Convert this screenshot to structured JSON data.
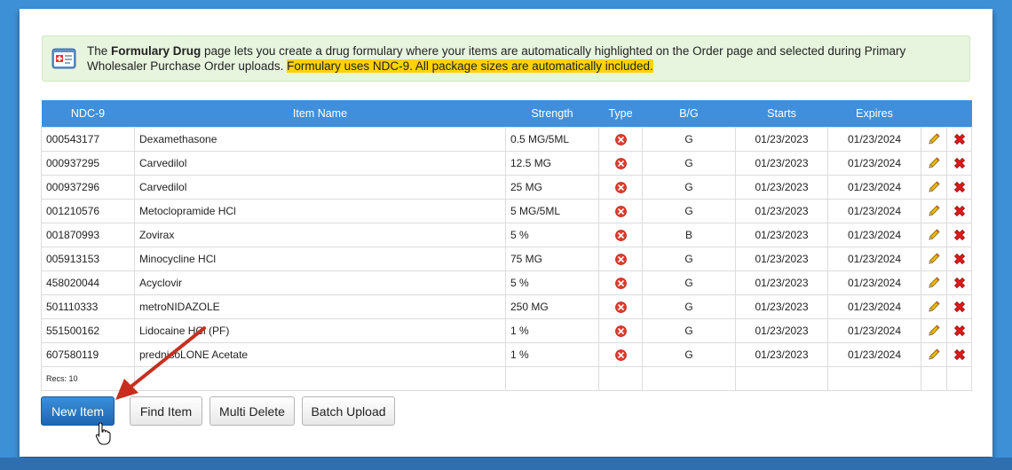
{
  "info": {
    "prefix": "The ",
    "bold": "Formulary Drug",
    "middle": " page lets you create a drug formulary where your items are automatically highlighted on the Order page and selected during Primary Wholesaler Purchase Order uploads. ",
    "highlight": "Formulary uses NDC-9. All package sizes are automatically included.",
    "icon": "formulary-icon"
  },
  "table": {
    "headers": {
      "ndc": "NDC-9",
      "item": "Item Name",
      "strength": "Strength",
      "type": "Type",
      "bg": "B/G",
      "starts": "Starts",
      "expires": "Expires"
    },
    "rows": [
      {
        "ndc": "000543177",
        "item": "Dexamethasone",
        "strength": "0.5 MG/5ML",
        "bg": "G",
        "starts": "01/23/2023",
        "expires": "01/23/2024"
      },
      {
        "ndc": "000937295",
        "item": "Carvedilol",
        "strength": "12.5 MG",
        "bg": "G",
        "starts": "01/23/2023",
        "expires": "01/23/2024"
      },
      {
        "ndc": "000937296",
        "item": "Carvedilol",
        "strength": "25 MG",
        "bg": "G",
        "starts": "01/23/2023",
        "expires": "01/23/2024"
      },
      {
        "ndc": "001210576",
        "item": "Metoclopramide HCl",
        "strength": "5 MG/5ML",
        "bg": "G",
        "starts": "01/23/2023",
        "expires": "01/23/2024"
      },
      {
        "ndc": "001870993",
        "item": "Zovirax",
        "strength": "5 %",
        "bg": "B",
        "starts": "01/23/2023",
        "expires": "01/23/2024"
      },
      {
        "ndc": "005913153",
        "item": "Minocycline HCl",
        "strength": "75 MG",
        "bg": "G",
        "starts": "01/23/2023",
        "expires": "01/23/2024"
      },
      {
        "ndc": "458020044",
        "item": "Acyclovir",
        "strength": "5 %",
        "bg": "G",
        "starts": "01/23/2023",
        "expires": "01/23/2024"
      },
      {
        "ndc": "501110333",
        "item": "metroNIDAZOLE",
        "strength": "250 MG",
        "bg": "G",
        "starts": "01/23/2023",
        "expires": "01/23/2024"
      },
      {
        "ndc": "551500162",
        "item": "Lidocaine HCl (PF)",
        "strength": "1 %",
        "bg": "G",
        "starts": "01/23/2023",
        "expires": "01/23/2024"
      },
      {
        "ndc": "607580119",
        "item": "prednisoLONE Acetate",
        "strength": "1 %",
        "bg": "G",
        "starts": "01/23/2023",
        "expires": "01/23/2024"
      }
    ],
    "type_icon": "red-x-circle-icon",
    "edit_icon": "pencil-icon",
    "delete_icon": "red-x-icon",
    "recs": "Recs: 10"
  },
  "buttons": {
    "new_item": "New Item",
    "find_item": "Find Item",
    "multi_delete": "Multi Delete",
    "batch_upload": "Batch Upload"
  },
  "colors": {
    "header_blue": "#3f8fdc",
    "info_green": "#e7f5de",
    "highlight_yellow": "#ffd200",
    "arrow_red": "#c62f1f",
    "frame_blue": "#3d8fd6"
  }
}
